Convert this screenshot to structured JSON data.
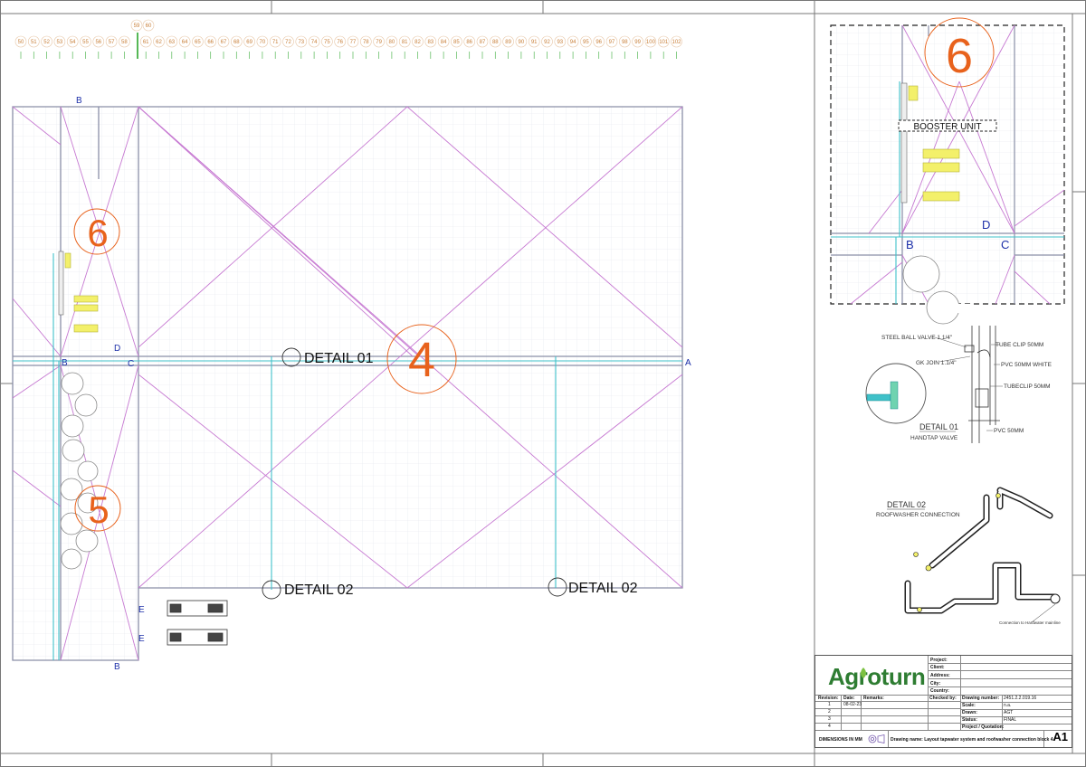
{
  "ruler": {
    "numbers": [
      "50",
      "51",
      "52",
      "53",
      "54",
      "55",
      "56",
      "57",
      "58",
      "59",
      "60",
      "61",
      "62",
      "63",
      "64",
      "65",
      "66",
      "67",
      "68",
      "69",
      "70",
      "71",
      "72",
      "73",
      "74",
      "75",
      "76",
      "77",
      "78",
      "79",
      "80",
      "81",
      "82",
      "83",
      "84",
      "85",
      "86",
      "87",
      "88",
      "89",
      "90",
      "91",
      "92",
      "93",
      "94",
      "95",
      "96",
      "97",
      "98",
      "99",
      "100",
      "101",
      "102"
    ]
  },
  "plan": {
    "area_labels": {
      "block6": "6",
      "block4": "4",
      "block5": "5"
    },
    "section_markers": {
      "b_top": "B",
      "b_left": "B",
      "c_left": "C",
      "d_top": "D",
      "a_right": "A",
      "e1": "E",
      "e2": "E",
      "b_bottom": "B"
    },
    "callouts": {
      "detail01": "DETAIL 01",
      "detail02_left": "DETAIL 02",
      "detail02_right": "DETAIL 02"
    }
  },
  "inset": {
    "area_label": "6",
    "booster_label": "BOOSTER UNIT",
    "markers": {
      "d": "D",
      "b": "B",
      "c": "C"
    }
  },
  "detail01": {
    "labels": {
      "ball_valve": "STEEL BALL VALVE 1.1/4\"",
      "tube_clip_top": "TUBE CLIP 50MM",
      "gk_join": "GK JOIN 1.1/4\"",
      "pvc_white": "PVC 50MM WHITE",
      "tubeclip": "TUBECLIP 50MM",
      "pvc_bottom": "PVC 50MM"
    },
    "title": "DETAIL 01",
    "subtitle": "HANDTAP VALVE"
  },
  "detail02": {
    "title": "DETAIL 02",
    "subtitle": "ROOFWASHER CONNECTION",
    "note": "Connection to Hardwater mainline"
  },
  "title_block": {
    "logo": "Agroturn",
    "project_labels": [
      "Project:",
      "Client:",
      "Address:",
      "City:",
      "Country:"
    ],
    "revision_headers": {
      "rev": "Revision:",
      "date": "Date:",
      "remarks": "Remarks:",
      "checked": "Checked by:"
    },
    "revisions": [
      {
        "no": "1",
        "date": "08-02-23"
      },
      {
        "no": "2",
        "date": ""
      },
      {
        "no": "3",
        "date": ""
      },
      {
        "no": "4",
        "date": ""
      }
    ],
    "fields": [
      {
        "label": "Drawing number:",
        "value": "2451.2.2.019.16"
      },
      {
        "label": "Scale:",
        "value": "n.a."
      },
      {
        "label": "Drawn:",
        "value": "AGT"
      },
      {
        "label": "Status:",
        "value": "FINAL"
      },
      {
        "label": "Project / Quotation:",
        "value": ""
      }
    ],
    "dimensions_note": "DIMENSIONS IN MM",
    "drawing_name": "Drawing name: Layout tapwater system and roofwasher connection block 4",
    "sheet_size": "A1"
  },
  "colors": {
    "boundary": "#8a8fa8",
    "grid": "#e3e6ec",
    "diagonal": "#c77ad2",
    "pipe": "#3fc1c9",
    "area_label": "#e8621c",
    "marker": "#1c2fa8",
    "ruler": "#c9803a",
    "ruler_ticks": "#56b856",
    "equipment": "#d4d23e",
    "brand_green": "#2e7d32"
  }
}
